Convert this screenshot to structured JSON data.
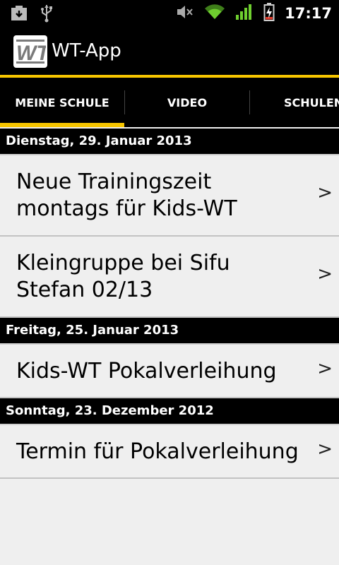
{
  "status_bar": {
    "time": "17:17",
    "icons": [
      "screenshot-icon",
      "usb-icon",
      "mute-icon",
      "wifi-icon",
      "signal-icon",
      "battery-charging-icon"
    ]
  },
  "action_bar": {
    "logo_text": "WT",
    "title": "WT-App"
  },
  "tabs": [
    {
      "label": "MEINE SCHULE",
      "selected": true
    },
    {
      "label": "VIDEO",
      "selected": false
    },
    {
      "label": "SCHULEN",
      "selected": false
    }
  ],
  "colors": {
    "accent": "#f7c600",
    "header_bg": "#000000",
    "list_bg": "#efefef"
  },
  "sections": [
    {
      "date": "Dienstag, 29. Januar 2013",
      "items": [
        {
          "title": "Neue Trainingszeit montags für Kids-WT",
          "chevron": ">"
        },
        {
          "title": "Kleingruppe bei Sifu Stefan 02/13",
          "chevron": ">"
        }
      ]
    },
    {
      "date": "Freitag, 25. Januar 2013",
      "items": [
        {
          "title": "Kids-WT Pokalverleihung",
          "chevron": ">"
        }
      ]
    },
    {
      "date": "Sonntag, 23. Dezember 2012",
      "items": [
        {
          "title": "Termin für Pokalverleihung",
          "chevron": ">"
        }
      ]
    }
  ]
}
